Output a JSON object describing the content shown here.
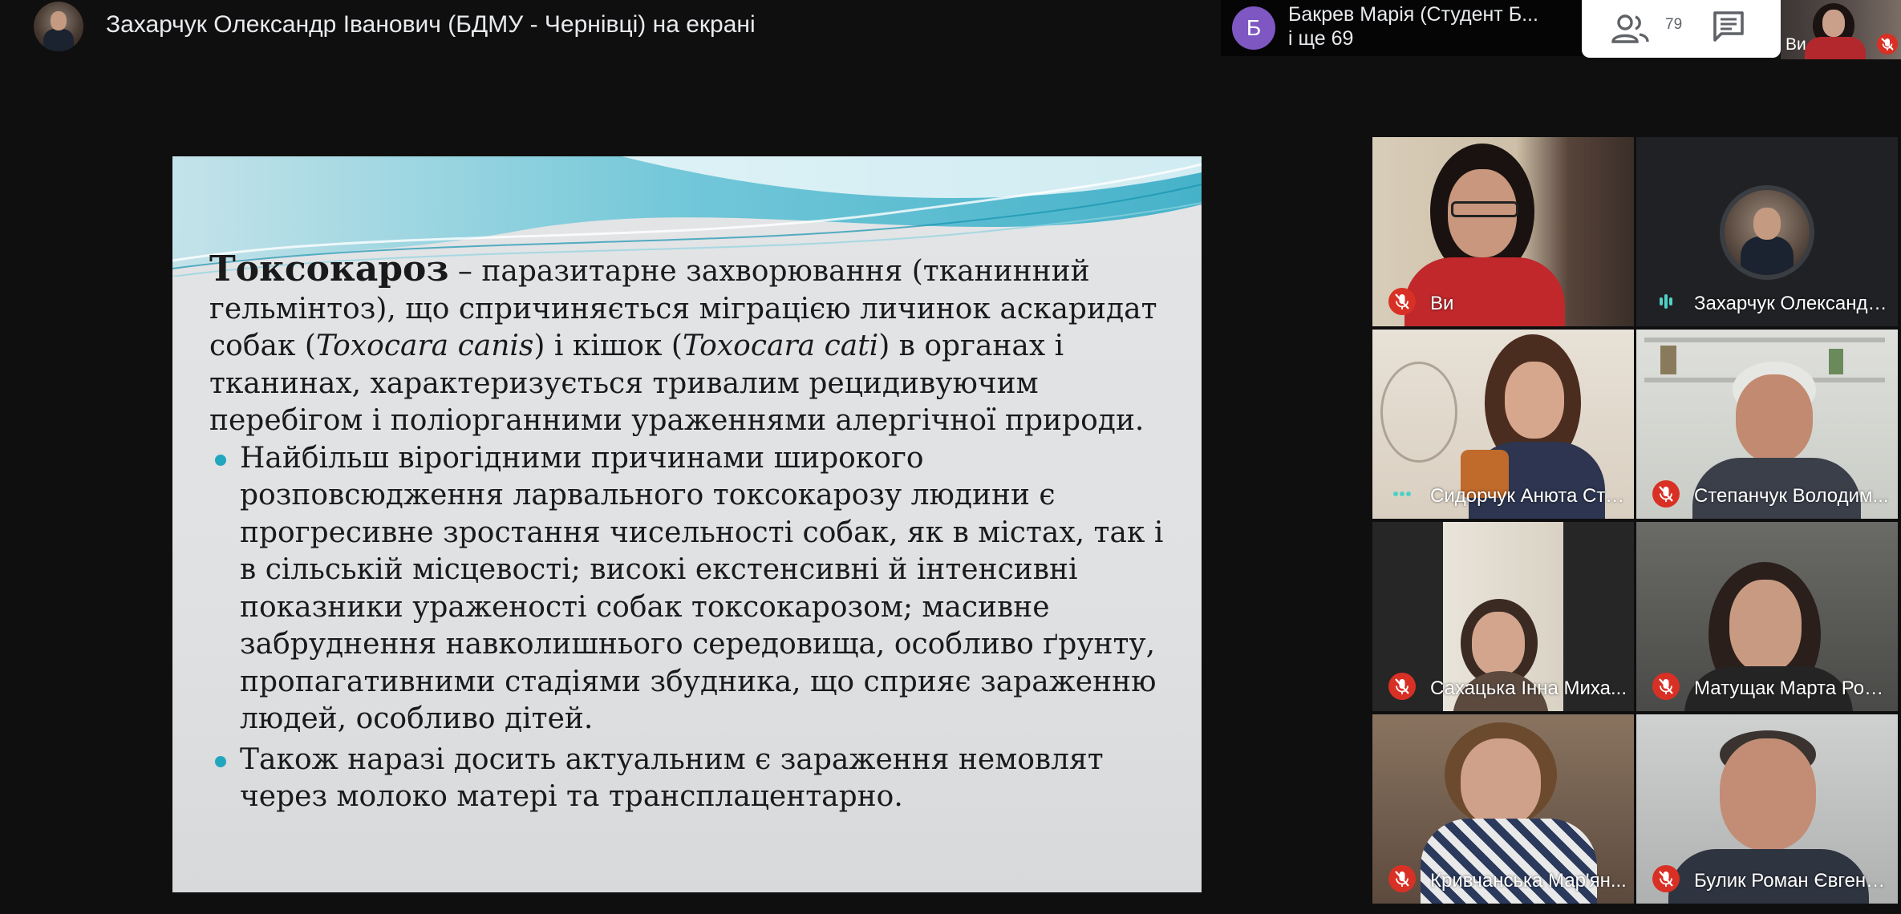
{
  "presenter": {
    "title": "Захарчук Олександр Іванович (БДМУ - Чернівці) на екрані"
  },
  "participants_bar": {
    "initial": "Б",
    "avatar_color": "#7e57c2",
    "name": "Бакрев Марія (Студент Б...",
    "more": "і ще 69"
  },
  "controls": {
    "people_count": "79",
    "people_icon": "people-icon",
    "chat_icon": "chat-icon"
  },
  "self_view": {
    "label": "Ви"
  },
  "slide": {
    "heading": "Токсокароз",
    "intro_rest_1": " – паразитарне захворювання (тканинний гельмінтоз), що спричиняється міграцією личинок аскаридат собак (",
    "intro_species_1": "Toxocara canis",
    "intro_rest_2": ") і кішок (",
    "intro_species_2": "Toxocara cati",
    "intro_rest_3": ") в органах і тканинах, характеризується тривалим рецидивуючим перебігом і поліорганними ураженнями алергічної природи.",
    "bullets": [
      "Найбільш вірогідними причинами широкого розповсюдження ларвального токсокарозу людини є прогресивне зростання чисельності собак, як в містах, так і в сільській місцевості; високі екстенсивні й інтенсивні показники ураженості собак токсокарозом; масивне забруднення навколишнього середовища, особливо ґрунту, пропагативними стадіями збудника, що сприяє зараженню людей, особливо дітей.",
      "Також наразі досить актуальним є зараження немовлят через молоко матері та трансплацентарно."
    ],
    "bullet_color": "#22a6bd"
  },
  "tiles": [
    {
      "name": "Ви",
      "status": "muted"
    },
    {
      "name": "Захарчук Олександр...",
      "status": "speaking"
    },
    {
      "name": "Сидорчук Анюта Сте...",
      "status": "speaking-dots"
    },
    {
      "name": "Степанчук Володим...",
      "status": "muted"
    },
    {
      "name": "Сахацька Інна Миха...",
      "status": "muted"
    },
    {
      "name": "Матущак Марта Ром...",
      "status": "muted"
    },
    {
      "name": "Кривчанська Мар'ян...",
      "status": "muted"
    },
    {
      "name": "Булик Роман Євгено...",
      "status": "muted"
    }
  ],
  "colors": {
    "muted_red": "#d93025",
    "speaking_teal": "#4fd1c5"
  }
}
